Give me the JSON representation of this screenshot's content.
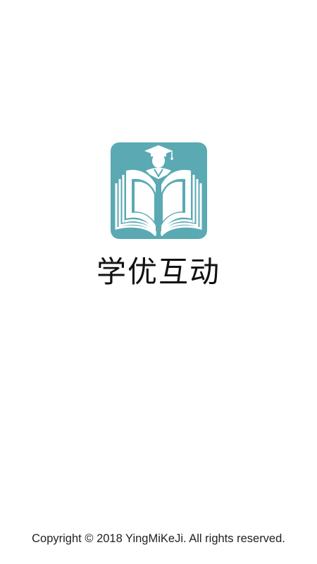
{
  "app": {
    "name": "学优互动",
    "logo_icon": "open-book-graduate-icon",
    "logo_color": "#5aa9b3"
  },
  "footer": {
    "copyright": "Copyright © 2018 YingMiKeJi. All rights reserved."
  }
}
